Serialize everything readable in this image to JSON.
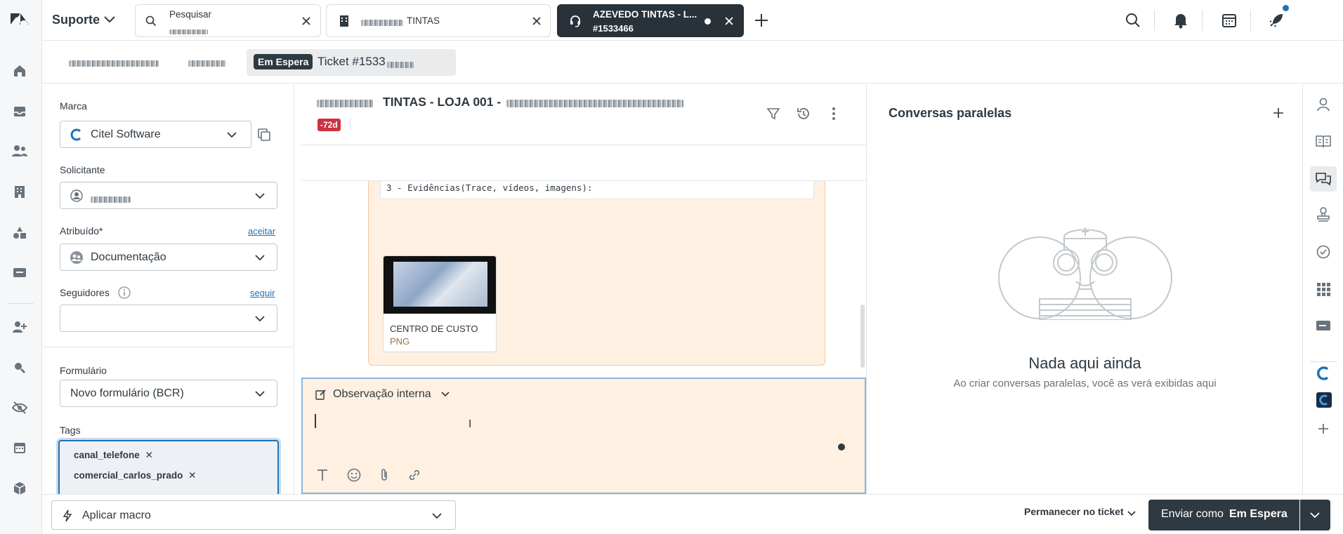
{
  "topbar": {
    "product": "Suporte",
    "tabs": [
      {
        "title": "Pesquisar",
        "subtitle": ""
      },
      {
        "title": "TINTAS"
      },
      {
        "title": "AZEVEDO TINTAS - L...",
        "subtitle": "#1533466"
      }
    ]
  },
  "subbar": {
    "status_badge": "Em Espera",
    "ticket_label": "Ticket #1533"
  },
  "props": {
    "marca_label": "Marca",
    "marca_value": "Citel Software",
    "solicitante_label": "Solicitante",
    "atribuido_label": "Atribuído*",
    "aceitar_link": "aceitar",
    "atribuido_value": "Documentação",
    "seguidores_label": "Seguidores",
    "seguir_link": "seguir",
    "formulario_label": "Formulário",
    "formulario_value": "Novo formulário (BCR)",
    "tags_label": "Tags",
    "tags": [
      "canal_telefone",
      "comercial_carlos_prado"
    ]
  },
  "conversation": {
    "header_title": "TINTAS - LOJA 001 -",
    "age_badge": "-72d",
    "evidence_text": "3 - Evidências(Trace, vídeos, imagens):",
    "attachment_name": "CENTRO DE CUSTO",
    "attachment_type": "PNG",
    "composer_mode": "Observação interna"
  },
  "side": {
    "title": "Conversas paralelas",
    "empty_title": "Nada aqui ainda",
    "empty_subtitle": "Ao criar conversas paralelas, você as verá exibidas aqui"
  },
  "bottombar": {
    "macro_label": "Aplicar macro",
    "stay_label": "Permanecer no ticket",
    "submit_prefix": "Enviar como",
    "submit_status": "Em Espera"
  },
  "colors": {
    "brand": "#293139",
    "accent": "#1f73b7",
    "danger": "#cc3340",
    "note_bg": "#fff0e1",
    "note_border": "#f3c89e"
  }
}
